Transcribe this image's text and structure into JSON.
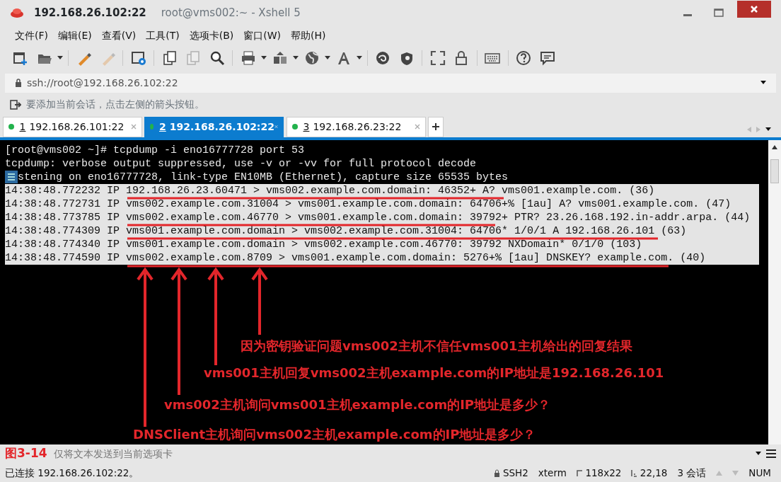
{
  "window": {
    "title": "192.168.26.102:22",
    "subtitle": "root@vms002:~ - Xshell 5"
  },
  "menu": [
    {
      "label": "文件(F)"
    },
    {
      "label": "编辑(E)"
    },
    {
      "label": "查看(V)"
    },
    {
      "label": "工具(T)"
    },
    {
      "label": "选项卡(B)"
    },
    {
      "label": "窗口(W)"
    },
    {
      "label": "帮助(H)"
    }
  ],
  "toolbar": [
    {
      "kind": "new",
      "disabled": false,
      "dropdown": false
    },
    {
      "kind": "folder",
      "disabled": false,
      "dropdown": true
    },
    {
      "kind": "sep"
    },
    {
      "kind": "pen",
      "disabled": false,
      "dropdown": false
    },
    {
      "kind": "pen",
      "disabled": true,
      "dropdown": false
    },
    {
      "kind": "sep"
    },
    {
      "kind": "settings",
      "disabled": false,
      "dropdown": false
    },
    {
      "kind": "sep"
    },
    {
      "kind": "copy",
      "disabled": false,
      "dropdown": false
    },
    {
      "kind": "copy",
      "disabled": true,
      "dropdown": false
    },
    {
      "kind": "search",
      "disabled": false,
      "dropdown": false
    },
    {
      "kind": "sep"
    },
    {
      "kind": "print",
      "disabled": false,
      "dropdown": true
    },
    {
      "kind": "transfer",
      "disabled": false,
      "dropdown": true
    },
    {
      "kind": "globe",
      "disabled": false,
      "dropdown": true
    },
    {
      "kind": "font",
      "disabled": false,
      "dropdown": true
    },
    {
      "kind": "sep"
    },
    {
      "kind": "swirl",
      "disabled": false,
      "dropdown": false
    },
    {
      "kind": "shield",
      "disabled": false,
      "dropdown": false
    },
    {
      "kind": "sep"
    },
    {
      "kind": "fullscreen",
      "disabled": false,
      "dropdown": false
    },
    {
      "kind": "lock",
      "disabled": false,
      "dropdown": false
    },
    {
      "kind": "sep"
    },
    {
      "kind": "keyboard",
      "disabled": false,
      "dropdown": false
    },
    {
      "kind": "sep"
    },
    {
      "kind": "help",
      "disabled": false,
      "dropdown": false
    },
    {
      "kind": "chat",
      "disabled": false,
      "dropdown": false
    }
  ],
  "address": {
    "value": "ssh://root@192.168.26.102:22"
  },
  "hint": "要添加当前会话，点击左侧的箭头按钮。",
  "tabs": [
    {
      "number": "1",
      "label": "192.168.26.101:22",
      "selected": false,
      "connected": true
    },
    {
      "number": "2",
      "label": "192.168.26.102:22",
      "selected": true,
      "connected": true
    },
    {
      "number": "3",
      "label": "192.168.26.23:22",
      "selected": false,
      "connected": true
    }
  ],
  "terminal": {
    "lines": [
      {
        "text": "[root@vms002 ~]# tcpdump -i eno16777728 port 53",
        "selected": false
      },
      {
        "text": "tcpdump: verbose output suppressed, use -v or -vv for full protocol decode",
        "selected": false
      },
      {
        "text": "stening on eno16777728, link-type EN10MB (Ethernet), capture size 65535 bytes",
        "selected": false,
        "covered": true
      },
      {
        "text": "14:38:48.772232 IP 192.168.26.23.60471 > vms002.example.com.domain: 46352+ A? vms001.example.com. (36)",
        "selected": true
      },
      {
        "text": "14:38:48.772731 IP vms002.example.com.31004 > vms001.example.com.domain: 64706+% [1au] A? vms001.example.com. (47)",
        "selected": true
      },
      {
        "text": "14:38:48.773785 IP vms002.example.com.46770 > vms001.example.com.domain: 39792+ PTR? 23.26.168.192.in-addr.arpa. (44)",
        "selected": true
      },
      {
        "text": "14:38:48.774309 IP vms001.example.com.domain > vms002.example.com.31004: 64706* 1/0/1 A 192.168.26.101 (63)",
        "selected": true
      },
      {
        "text": "14:38:48.774340 IP vms001.example.com.domain > vms002.example.com.46770: 39792 NXDomain* 0/1/0 (103)",
        "selected": true
      },
      {
        "text": "14:38:48.774590 IP vms002.example.com.8709 > vms001.example.com.domain: 5276+% [1au] DNSKEY? example.com. (40)",
        "selected": true
      }
    ]
  },
  "annotations": [
    "因为密钥验证问题vms002主机不信任vms001主机给出的回复结果",
    "vms001主机回复vms002主机example.com的IP地址是192.168.26.101",
    "vms002主机询问vms001主机example.com的IP地址是多少？",
    "DNSClient主机询问vms002主机example.com的IP地址是多少？"
  ],
  "figure_label": "图3-14",
  "send_bar": {
    "placeholder": "仅将文本发送到当前选项卡"
  },
  "status": {
    "connection": "已连接 192.168.26.102:22。",
    "protocol": "SSH2",
    "term": "xterm",
    "size": "118x22",
    "cursor": "22,18",
    "sessions": "3 会话",
    "num": "NUM"
  }
}
